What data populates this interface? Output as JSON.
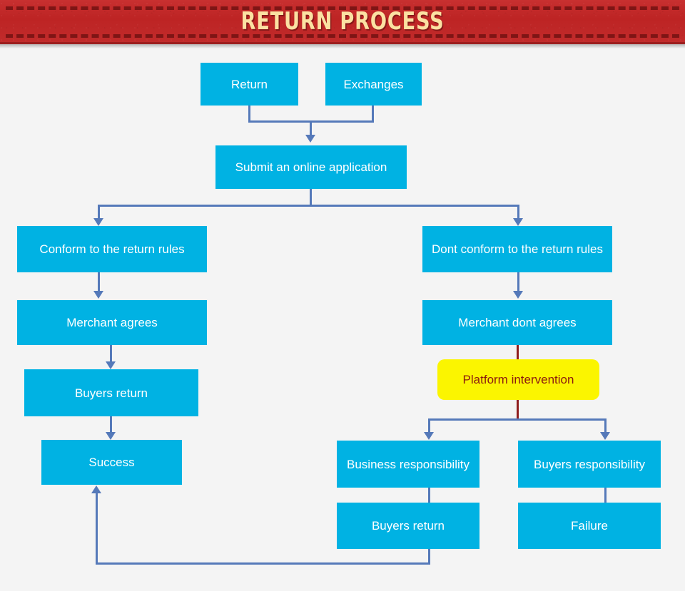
{
  "banner": {
    "title": "RETURN PROCESS",
    "background_color": "#c22a2a",
    "title_color": "#fbe1a2",
    "dash_color": "#7e1515"
  },
  "canvas": {
    "background_color": "#f4f4f4",
    "node_color": "#00b2e3",
    "node_text_color": "#ffffff",
    "highlight_color": "#fbf500",
    "highlight_text_color": "#8b1a10",
    "connector_color": "#5579b9",
    "red_connector_color": "#8f1d1d"
  },
  "nodes": {
    "return": "Return",
    "exchanges": "Exchanges",
    "submit_application": "Submit an online application",
    "conform_rules": "Conform to the return rules",
    "dont_conform_rules": "Dont conform to the return rules",
    "merchant_agrees": "Merchant agrees",
    "merchant_dont_agrees": "Merchant dont agrees",
    "buyers_return_left": "Buyers return",
    "platform_intervention": "Platform intervention",
    "success": "Success",
    "business_responsibility": "Business responsibility",
    "buyers_responsibility": "Buyers responsibility",
    "buyers_return_right": "Buyers return",
    "failure": "Failure"
  }
}
